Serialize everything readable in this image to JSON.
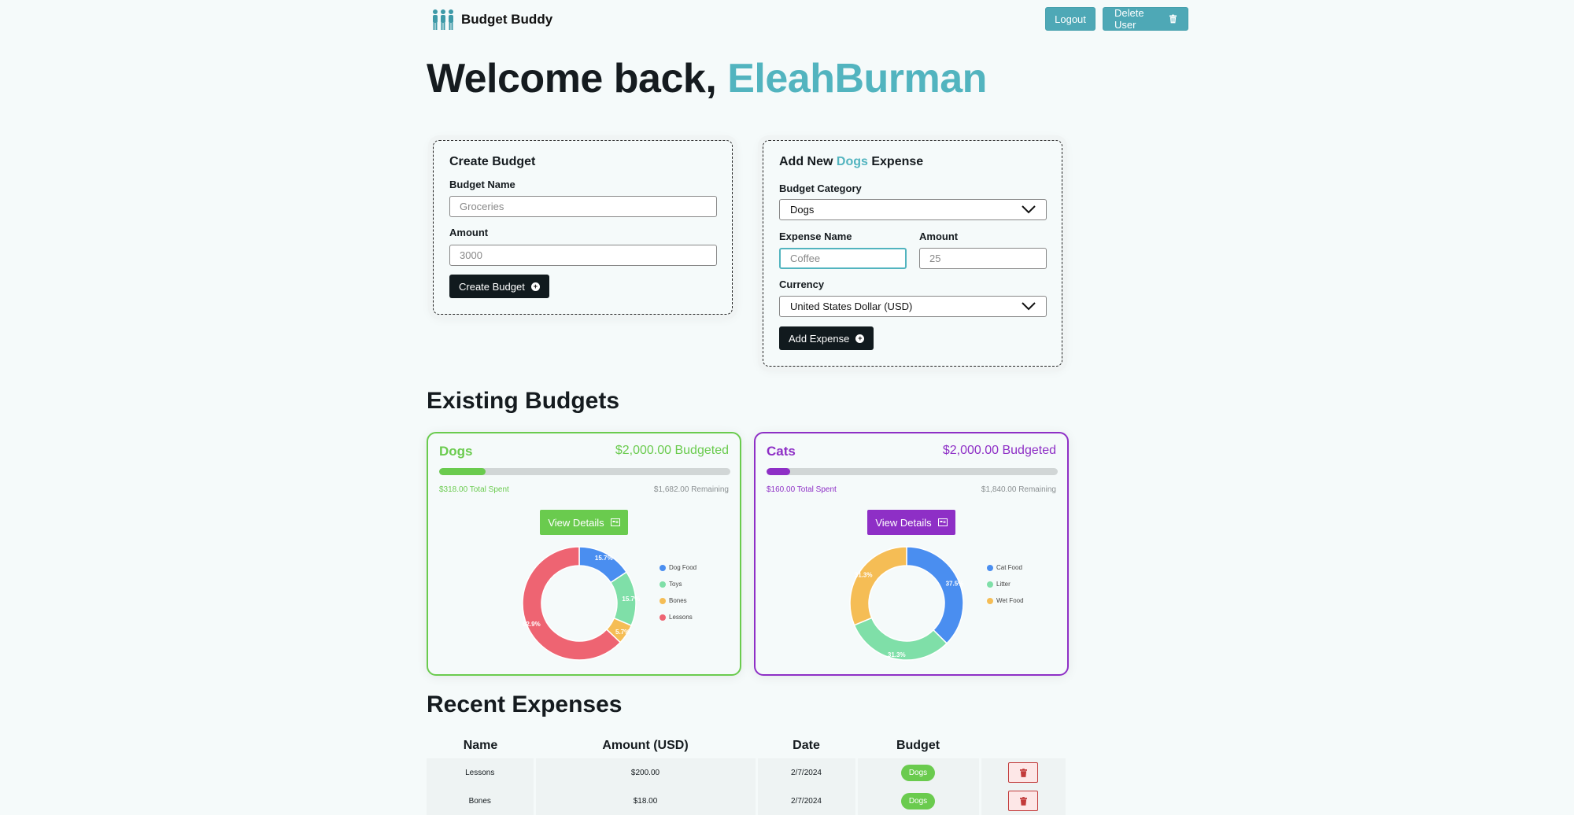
{
  "header": {
    "app_name": "Budget Buddy",
    "logout_label": "Logout",
    "delete_user_label": "Delete User"
  },
  "welcome": {
    "prefix": "Welcome back,",
    "username": "EleahBurman"
  },
  "create_budget": {
    "title": "Create Budget",
    "name_label": "Budget Name",
    "name_placeholder": "Groceries",
    "amount_label": "Amount",
    "amount_placeholder": "3000",
    "submit_label": "Create Budget"
  },
  "add_expense": {
    "title_prefix": "Add New",
    "title_category": "Dogs",
    "title_suffix": "Expense",
    "category_label": "Budget Category",
    "category_value": "Dogs",
    "name_label": "Expense Name",
    "name_placeholder": "Coffee",
    "amount_label": "Amount",
    "amount_placeholder": "25",
    "currency_label": "Currency",
    "currency_value": "United States Dollar (USD)",
    "submit_label": "Add Expense"
  },
  "existing_budgets": {
    "heading": "Existing Budgets",
    "budgets": [
      {
        "name": "Dogs",
        "budgeted": "$2,000.00 Budgeted",
        "spent": "$318.00 Total Spent",
        "remaining": "$1,682.00 Remaining",
        "progress": 0.159,
        "color": "#6acb4e",
        "view_label": "View Details",
        "chart_data": {
          "type": "pie",
          "donut": true,
          "categories": [
            "Dog Food",
            "Toys",
            "Bones",
            "Lessons"
          ],
          "values": [
            15.7,
            15.7,
            5.7,
            62.9
          ],
          "labels": [
            "15.7%",
            "15.7%",
            "5.7%",
            "62.9%"
          ],
          "colors": [
            "#4a8ef0",
            "#7fdfa8",
            "#f5bd55",
            "#ee6472"
          ],
          "legend": "right"
        }
      },
      {
        "name": "Cats",
        "budgeted": "$2,000.00 Budgeted",
        "spent": "$160.00 Total Spent",
        "remaining": "$1,840.00 Remaining",
        "progress": 0.08,
        "color": "#8e2fc6",
        "view_label": "View Details",
        "chart_data": {
          "type": "pie",
          "donut": true,
          "categories": [
            "Cat Food",
            "Litter",
            "Wet Food"
          ],
          "values": [
            37.5,
            31.3,
            31.3
          ],
          "labels": [
            "37.5%",
            "31.3%",
            "31.3%"
          ],
          "colors": [
            "#4a8ef0",
            "#7fdfa8",
            "#f5bd55"
          ],
          "legend": "right"
        }
      }
    ]
  },
  "recent_expenses": {
    "heading": "Recent Expenses",
    "columns": [
      "Name",
      "Amount (USD)",
      "Date",
      "Budget",
      ""
    ],
    "rows": [
      {
        "name": "Lessons",
        "amount": "$200.00",
        "date": "2/7/2024",
        "budget": "Dogs"
      },
      {
        "name": "Bones",
        "amount": "$18.00",
        "date": "2/7/2024",
        "budget": "Dogs"
      }
    ]
  },
  "colors": {
    "accent": "#52b4bf",
    "dogs": "#6acb4e",
    "cats": "#8e2fc6",
    "dark": "#111a1e"
  }
}
